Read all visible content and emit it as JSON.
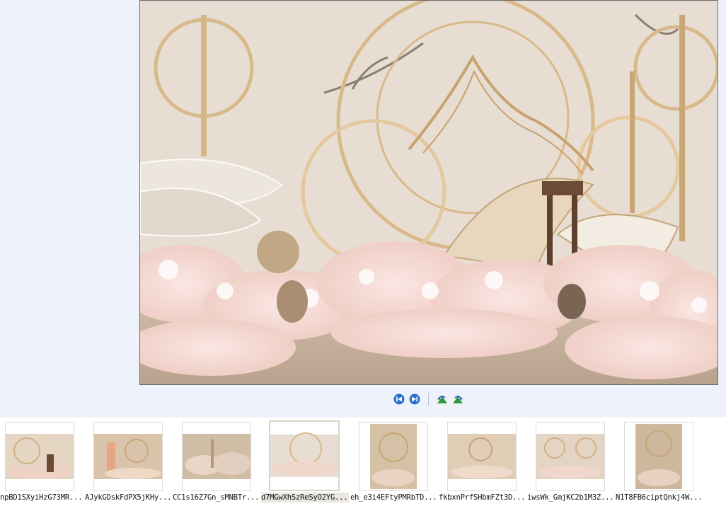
{
  "viewer": {
    "image_alt": "wedding stage floral decoration photo",
    "colors": {
      "background": "#eef3fb",
      "frame": "#6b6b6b"
    }
  },
  "toolbar": {
    "buttons": [
      {
        "name": "previous-image-button",
        "icon": "skip-previous-icon"
      },
      {
        "name": "next-image-button",
        "icon": "skip-next-icon"
      },
      {
        "name": "rotate-left-button",
        "icon": "rotate-left-icon"
      },
      {
        "name": "rotate-right-button",
        "icon": "rotate-right-icon"
      }
    ]
  },
  "thumbnails": [
    {
      "caption": "npBD1SXyiHzG73MR...",
      "selected": false
    },
    {
      "caption": "AJykGDskFdPX5jKHy...",
      "selected": false
    },
    {
      "caption": "CC1s16Z7Gn_sMNBTr...",
      "selected": false
    },
    {
      "caption": "d7MGwXhSzReSyO2YG...",
      "selected": true
    },
    {
      "caption": "eh_e3i4EFtyPMRbTD...",
      "selected": false
    },
    {
      "caption": "fkbxnPrfSHbmFZt3D...",
      "selected": false
    },
    {
      "caption": "iwsWk_GmjKC2b1M3Z...",
      "selected": false
    },
    {
      "caption": "N1T8FB6ciptQnkj4W...",
      "selected": false
    }
  ]
}
